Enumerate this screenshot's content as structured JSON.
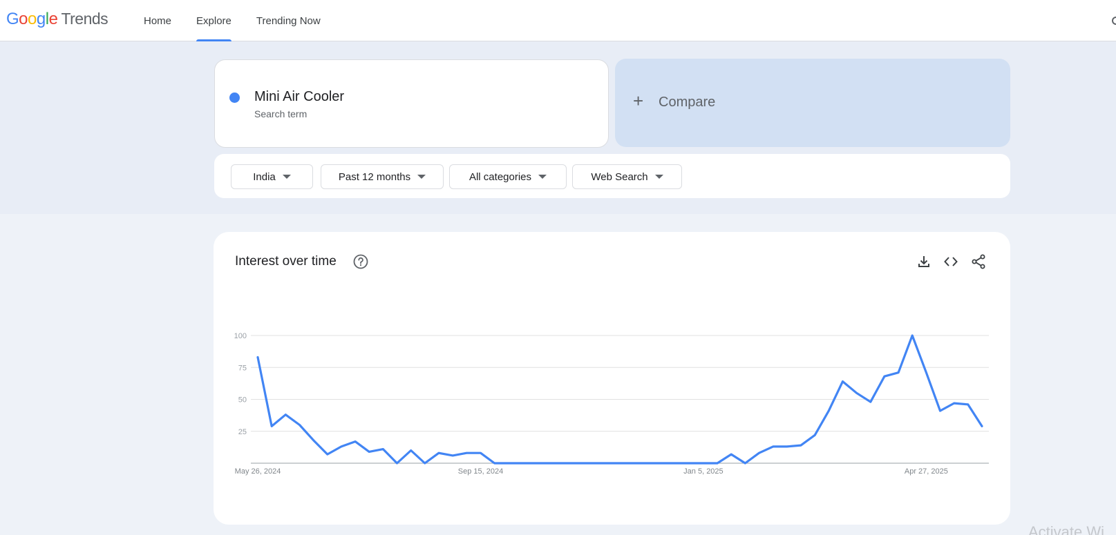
{
  "header": {
    "logo_letters": [
      {
        "ch": "G",
        "color": "#4285F4"
      },
      {
        "ch": "o",
        "color": "#EA4335"
      },
      {
        "ch": "o",
        "color": "#FBBC05"
      },
      {
        "ch": "g",
        "color": "#4285F4"
      },
      {
        "ch": "l",
        "color": "#34A853"
      },
      {
        "ch": "e",
        "color": "#EA4335"
      }
    ],
    "logo_product": "Trends",
    "tabs": [
      {
        "label": "Home",
        "active": false
      },
      {
        "label": "Explore",
        "active": true
      },
      {
        "label": "Trending Now",
        "active": false
      }
    ]
  },
  "search": {
    "term": "Mini Air Cooler",
    "term_type": "Search term",
    "term_color": "#4285F4",
    "compare_label": "Compare"
  },
  "filters": [
    {
      "label": "India"
    },
    {
      "label": "Past 12 months"
    },
    {
      "label": "All categories"
    },
    {
      "label": "Web Search"
    }
  ],
  "card": {
    "title": "Interest over time",
    "help_icon": "help-circle-icon",
    "tools": [
      "download-icon",
      "embed-code-icon",
      "share-icon"
    ]
  },
  "chart_data": {
    "type": "line",
    "title": "",
    "xlabel": "",
    "ylabel": "",
    "ylim": [
      0,
      100
    ],
    "yticks": [
      "25",
      "50",
      "75",
      "100"
    ],
    "xtick_labels": [
      {
        "label": "May 26, 2024",
        "index": 0
      },
      {
        "label": "Sep 15, 2024",
        "index": 16
      },
      {
        "label": "Jan 5, 2025",
        "index": 32
      },
      {
        "label": "Apr 27, 2025",
        "index": 48
      }
    ],
    "grid": true,
    "series": [
      {
        "color": "#4285F4",
        "values": [
          83,
          29,
          38,
          30,
          18,
          7,
          13,
          17,
          9,
          11,
          0,
          10,
          0,
          8,
          6,
          8,
          8,
          0,
          0,
          0,
          0,
          0,
          0,
          0,
          0,
          0,
          0,
          0,
          0,
          0,
          0,
          0,
          0,
          0,
          7,
          0,
          8,
          13,
          13,
          14,
          22,
          41,
          64,
          55,
          48,
          68,
          71,
          100,
          71,
          41,
          47,
          46,
          29
        ]
      }
    ]
  },
  "watermark": "Activate Wi"
}
